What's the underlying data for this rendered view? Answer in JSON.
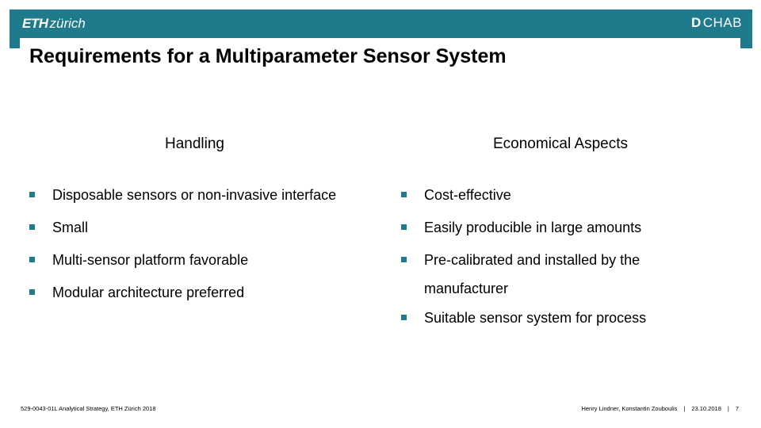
{
  "header": {
    "logo_bold": "ETH",
    "logo_light": "zürich",
    "dept_bold": "D",
    "dept_rest": "CHAB",
    "accent_color": "#1f7a8c"
  },
  "slide": {
    "title": "Requirements for a Multiparameter Sensor System",
    "columns": [
      {
        "heading": "Handling",
        "items": [
          "Disposable sensors or non-invasive interface",
          "Small",
          "Multi-sensor platform favorable",
          "Modular architecture preferred"
        ]
      },
      {
        "heading": "Economical Aspects",
        "items": [
          "Cost-effective",
          "Easily producible in large amounts",
          "Pre-calibrated and installed by the manufacturer",
          "Suitable sensor system for process"
        ]
      }
    ]
  },
  "footer": {
    "course": "529-0043-01L Analytical Strategy, ETH Zürich 2018",
    "authors": "Henry Lindner, Konstantin Zouboulis",
    "separator": "|",
    "date": "23.10.2018",
    "page_number": "7"
  }
}
